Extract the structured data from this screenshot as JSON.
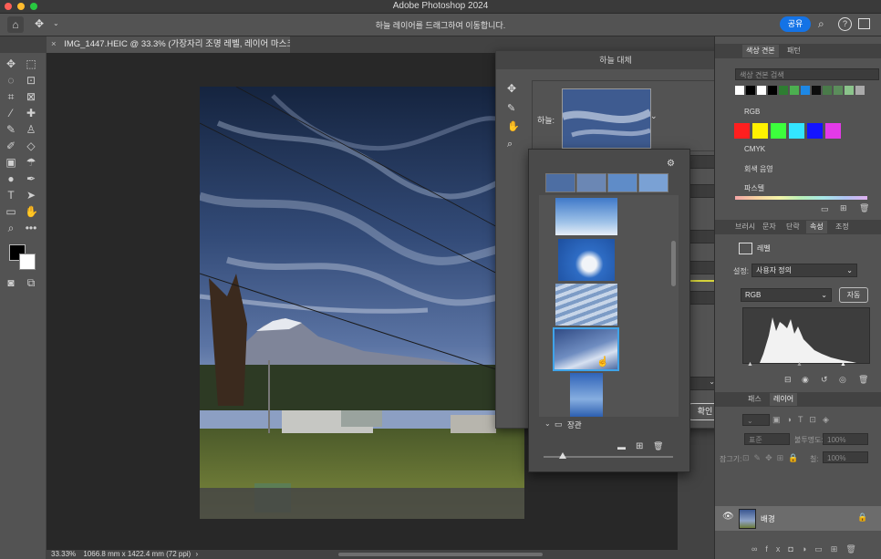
{
  "app": {
    "title": "Adobe Photoshop 2024",
    "hint": "하늘 레이어를 드래그하여 이동합니다.",
    "share_label": "공유"
  },
  "document": {
    "tab_title": "IMG_1447.HEIC @ 33.3% (가장자리 조명 레벨, 레이어 마스크/8) *",
    "zoom": "33.33%",
    "dimensions": "1066.8 mm x 1422.4 mm (72 ppi)"
  },
  "sky_dialog": {
    "title": "하늘 대체",
    "sky_label": "하늘:",
    "ok_label": "확인",
    "folder_label": "장관"
  },
  "right_panel": {
    "swatch_tabs": [
      "색상 견본",
      "패턴"
    ],
    "swatch_search_placeholder": "색상 견본 검색",
    "swatch_groups": [
      "RGB",
      "CMYK",
      "회색 음영",
      "파스텔"
    ],
    "props_tabs": [
      "브러시",
      "문자",
      "단락",
      "속성",
      "조정"
    ],
    "levels_label": "레벨",
    "preset_label": "설정:",
    "preset_value": "사용자 정의",
    "channel_value": "RGB",
    "auto_label": "자동",
    "layers_tabs": [
      "패스",
      "레이어"
    ],
    "blend_mode": "표준",
    "opacity_label": "불투명도:",
    "opacity_value": "100%",
    "lock_label": "잠그기:",
    "fill_label": "칠:",
    "fill_value": "100%",
    "layer_name": "배경"
  },
  "colors": {
    "accent": "#1473e6",
    "selection": "#3fa3e8"
  },
  "icons": [
    "apple-close",
    "home-icon",
    "move-icon",
    "search-icon",
    "help-icon",
    "settings-icon",
    "gear-icon",
    "folder-icon",
    "eye-icon",
    "lock-icon",
    "trash-icon",
    "hand-icon",
    "zoom-icon",
    "brush-icon"
  ]
}
